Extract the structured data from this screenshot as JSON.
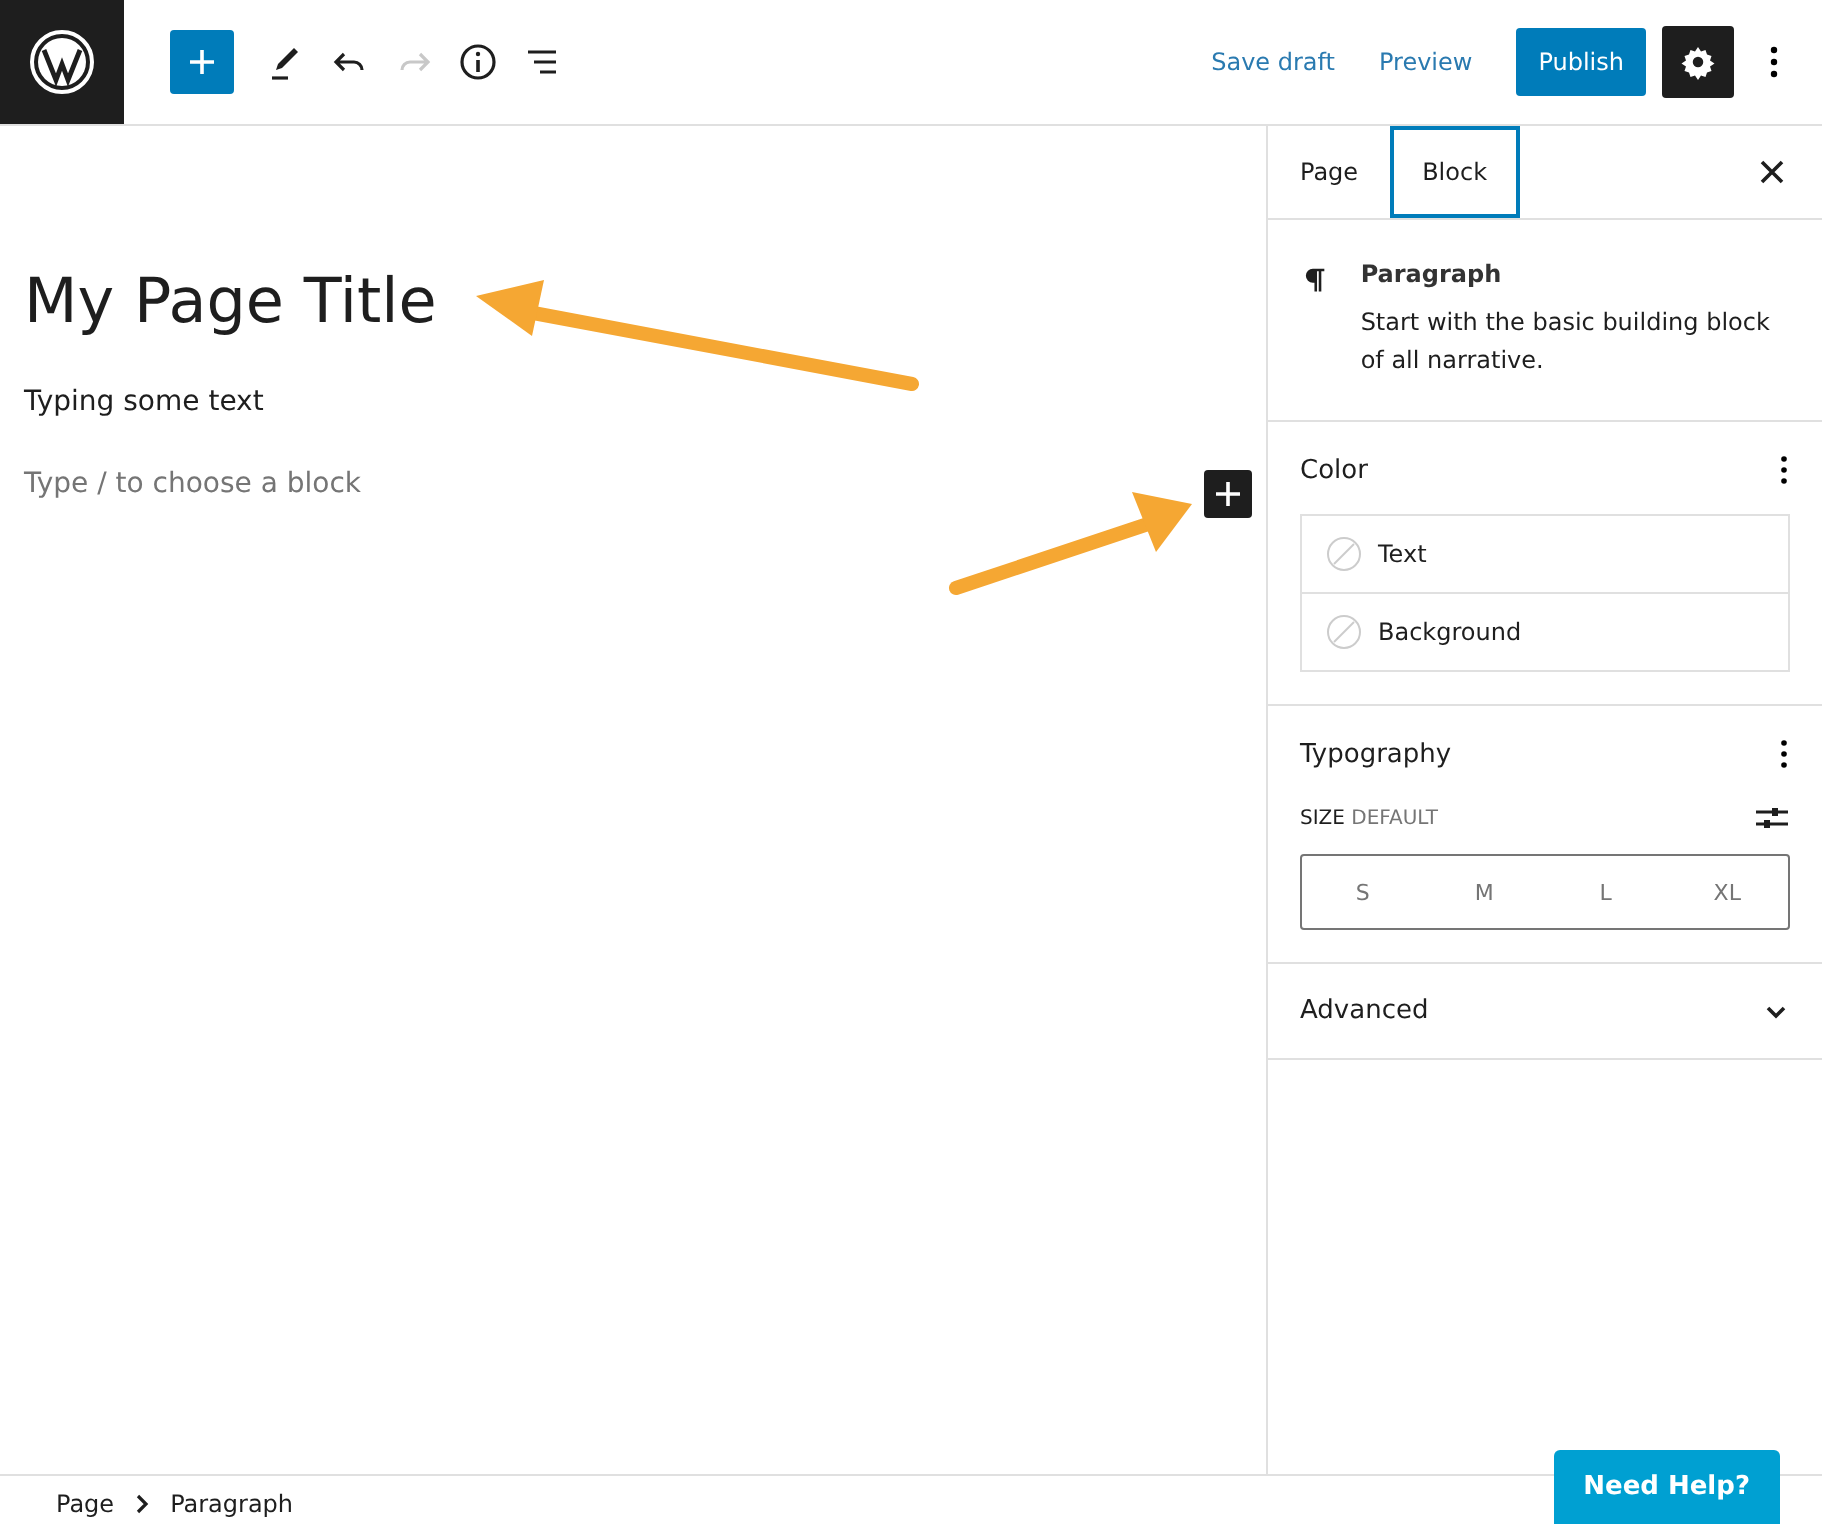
{
  "toolbar": {
    "tools": [
      {
        "kind": "add",
        "disabled": false
      },
      {
        "kind": "pen",
        "disabled": false
      },
      {
        "kind": "undo",
        "disabled": false
      },
      {
        "kind": "redo",
        "disabled": true
      },
      {
        "kind": "info",
        "disabled": false
      },
      {
        "kind": "outline",
        "disabled": false
      }
    ],
    "actions": {
      "save_draft": "Save draft",
      "preview": "Preview",
      "publish": "Publish"
    }
  },
  "editor": {
    "title": "My Page Title",
    "paragraph": "Typing some text",
    "placeholder": "Type / to choose a block"
  },
  "sidebar": {
    "tabs": [
      {
        "label": "Page",
        "selected": false
      },
      {
        "label": "Block",
        "selected": true
      }
    ],
    "block": {
      "name": "Paragraph",
      "description": "Start with the basic building block of all narrative."
    },
    "color": {
      "title": "Color",
      "items": [
        "Text",
        "Background"
      ]
    },
    "typography": {
      "title": "Typography",
      "size_label": "SIZE",
      "size_value": "DEFAULT",
      "sizes": [
        "S",
        "M",
        "L",
        "XL"
      ]
    },
    "advanced": {
      "title": "Advanced",
      "expanded": false
    }
  },
  "breadcrumb": [
    "Page",
    "Paragraph"
  ],
  "help_button": "Need Help?"
}
